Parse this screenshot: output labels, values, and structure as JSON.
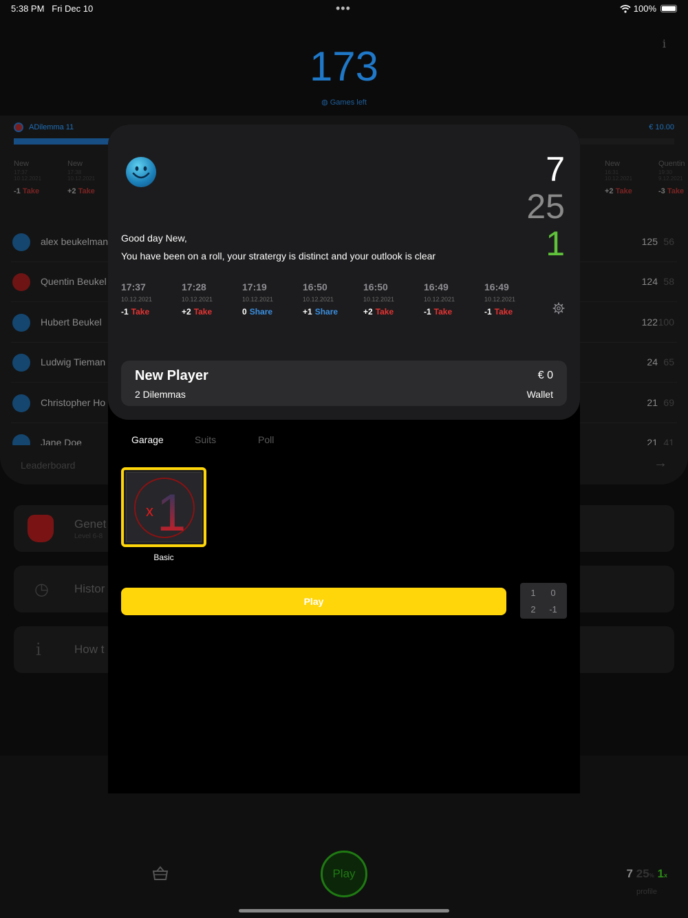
{
  "status_bar": {
    "time": "5:38 PM",
    "date": "Fri Dec 10",
    "dots": "•••",
    "battery": "100%"
  },
  "background": {
    "games_left": "173",
    "games_left_label": "Games left",
    "info_label": "i",
    "dilemma_name": "ADilemma 11",
    "pot": "€ 10.00",
    "mini_history_left": [
      {
        "name": "New",
        "time": "17:37",
        "date": "10.12.2021",
        "value": "-1",
        "action": "Take"
      },
      {
        "name": "New",
        "time": "17:38",
        "date": "10.12.2021",
        "value": "+2",
        "action": "Take"
      }
    ],
    "mini_history_right": [
      {
        "name": "New",
        "time": "16:31",
        "date": "10.12.2021",
        "value": "+2",
        "action": "Take"
      },
      {
        "name": "Quentin",
        "time": "19:30",
        "date": "9.12.2021",
        "value": "-3",
        "action": "Take"
      }
    ],
    "leaderboard": [
      {
        "name": "alex beukelman",
        "score": "125",
        "score2": "56"
      },
      {
        "name": "Quentin Beukel",
        "score": "124",
        "score2": "58"
      },
      {
        "name": "Hubert  Beukel",
        "score": "122",
        "score2": "100"
      },
      {
        "name": "Ludwig Tieman",
        "score": "24",
        "score2": "65"
      },
      {
        "name": "Christopher Ho",
        "score": "21",
        "score2": "69"
      },
      {
        "name": "Jane Doe",
        "score": "21",
        "score2": "41"
      }
    ],
    "leaderboard_label": "Leaderboard",
    "menu": [
      {
        "title": "Genet",
        "subtitle": "Level 6-8"
      },
      {
        "title": "Histor",
        "subtitle": ""
      },
      {
        "title": "How t",
        "subtitle": ""
      }
    ],
    "tabbar": {
      "play": "Play",
      "profile_a": "7",
      "profile_b": "25",
      "profile_b_suffix": "%",
      "profile_c": "1",
      "profile_c_suffix": "x",
      "profile_label": "profile"
    }
  },
  "sheet": {
    "stats": {
      "primary": "7",
      "secondary": "25",
      "tertiary": "1"
    },
    "greeting": "Good day New,",
    "message": "You have been on a roll, your stratergy is distinct and your outlook is clear",
    "history": [
      {
        "time": "17:37",
        "date": "10.12.2021",
        "value": "-1",
        "action": "Take",
        "kind": "take"
      },
      {
        "time": "17:28",
        "date": "10.12.2021",
        "value": "+2",
        "action": "Take",
        "kind": "take"
      },
      {
        "time": "17:19",
        "date": "10.12.2021",
        "value": "0",
        "action": "Share",
        "kind": "share"
      },
      {
        "time": "16:50",
        "date": "10.12.2021",
        "value": "+1",
        "action": "Share",
        "kind": "share"
      },
      {
        "time": "16:50",
        "date": "10.12.2021",
        "value": "+2",
        "action": "Take",
        "kind": "take"
      },
      {
        "time": "16:49",
        "date": "10.12.2021",
        "value": "-1",
        "action": "Take",
        "kind": "take"
      },
      {
        "time": "16:49",
        "date": "10.12.2021",
        "value": "-1",
        "action": "Take",
        "kind": "take"
      }
    ],
    "player": {
      "name": "New Player",
      "dilemmas": "2 Dilemmas",
      "wallet_value": "€ 0",
      "wallet_label": "Wallet"
    },
    "tabs": [
      {
        "label": "Garage",
        "active": true
      },
      {
        "label": "Suits",
        "active": false
      },
      {
        "label": "Poll",
        "active": false
      }
    ],
    "car": {
      "label": "Basic",
      "badge_x": "x",
      "badge_num": "1"
    },
    "play_label": "Play",
    "matrix": {
      "tl": "1",
      "tr": "0",
      "bl": "2",
      "br": "-1"
    },
    "colors": {
      "accent_yellow": "#ffd60a",
      "take_red": "#e63333",
      "share_blue": "#3b8fe0",
      "positive_green": "#5fc23a"
    }
  }
}
